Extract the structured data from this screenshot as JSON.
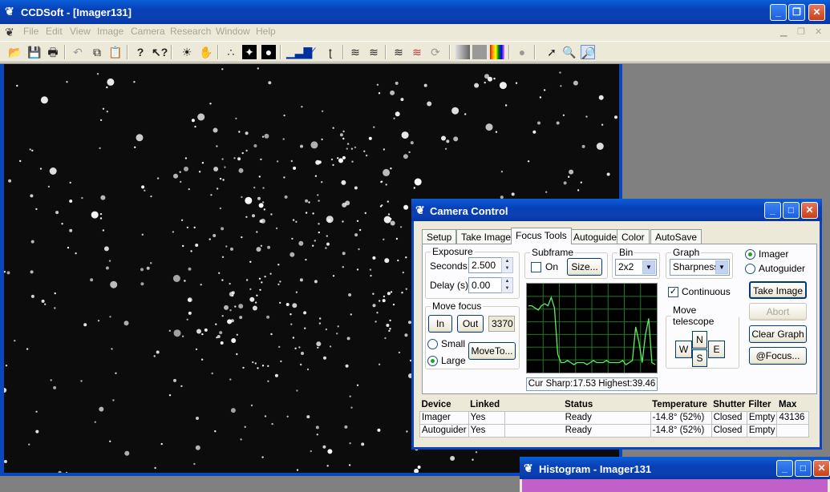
{
  "app": {
    "title": "CCDSoft  - [Imager131]"
  },
  "menu": [
    "File",
    "Edit",
    "View",
    "Image",
    "Camera",
    "Research",
    "Window",
    "Help"
  ],
  "toolbar": {
    "icons": [
      "open-icon",
      "save-icon",
      "print-icon",
      "undo-icon",
      "copy-icon",
      "paste-icon",
      "help-icon",
      "context-help-icon",
      "brightness-icon",
      "hand-icon",
      "star-icon",
      "stars-icon",
      "stars-alt-icon",
      "histogram-icon",
      "curve-icon",
      "transform-icon",
      "stack-icon",
      "stack-alt-icon",
      "combine-icon",
      "color-combine-icon",
      "rotate-icon",
      "gray-gradient-icon",
      "gray-icon",
      "rainbow-icon",
      "circle-icon",
      "pointer-icon",
      "zoom-in-icon",
      "zoom-out-icon"
    ]
  },
  "camera_control": {
    "title": "Camera Control",
    "tabs": [
      "Setup",
      "Take Image",
      "Focus Tools",
      "Autoguide",
      "Color",
      "AutoSave"
    ],
    "active_tab": "Focus Tools",
    "exposure": {
      "label": "Exposure",
      "seconds_label": "Seconds:",
      "seconds_value": "2.500",
      "delay_label": "Delay (s):",
      "delay_value": "0.00"
    },
    "subframe": {
      "label": "Subframe",
      "on_label": "On",
      "on_checked": false,
      "size_button": "Size..."
    },
    "bin": {
      "label": "Bin",
      "value": "2x2"
    },
    "graph": {
      "label": "Graph",
      "value": "Sharpness"
    },
    "target": {
      "imager_label": "Imager",
      "autoguider_label": "Autoguider",
      "selected": "Imager"
    },
    "continuous": {
      "label": "Continuous",
      "checked": true
    },
    "move_focus": {
      "label": "Move focus",
      "in_button": "In",
      "out_button": "Out",
      "position": "3370",
      "small_label": "Small",
      "large_label": "Large",
      "selected": "Large",
      "moveto_button": "MoveTo..."
    },
    "move_telescope": {
      "label": "Move telescope",
      "n": "N",
      "s": "S",
      "w": "W",
      "e": "E"
    },
    "buttons": {
      "take_image": "Take Image",
      "abort": "Abort",
      "clear_graph": "Clear Graph",
      "focus": "@Focus..."
    },
    "readout": "Cur Sharp:17.53 Highest:39.46",
    "graph_data": {
      "type": "line",
      "ylim": [
        0,
        40
      ],
      "series": [
        {
          "name": "",
          "values": [
            31,
            31,
            30,
            29,
            31,
            32,
            31,
            35,
            30,
            8,
            4,
            4,
            5,
            4,
            3,
            4,
            4,
            4,
            3,
            4,
            5,
            4,
            4,
            4,
            5,
            4,
            4,
            4,
            4,
            5,
            3,
            4,
            5,
            21,
            14,
            4,
            17,
            25,
            4,
            3
          ]
        }
      ]
    },
    "devices": {
      "headers": [
        "Device",
        "Linked",
        "Status",
        "Temperature",
        "Shutter",
        "Filter",
        "Max"
      ],
      "rows": [
        [
          "Imager",
          "Yes",
          "Ready",
          "-14.8° (52%)",
          "Closed",
          "Empty",
          "43136"
        ],
        [
          "Autoguider",
          "Yes",
          "Ready",
          "-14.8° (52%)",
          "Closed",
          "Empty",
          ""
        ]
      ]
    }
  },
  "histogram_window": {
    "title": "Histogram - Imager131"
  }
}
